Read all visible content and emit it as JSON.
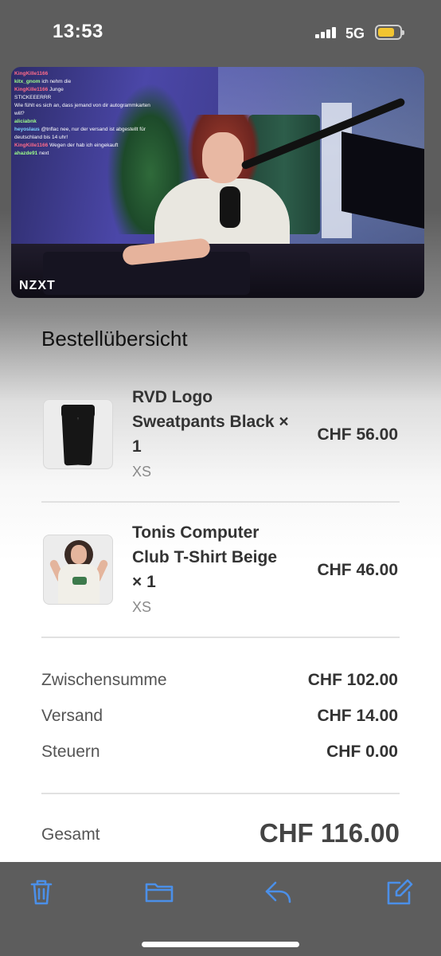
{
  "status_bar": {
    "time": "13:53",
    "network": "5G",
    "battery_color": "#f2c531"
  },
  "video": {
    "watermark": "NZXT",
    "chat": [
      {
        "user": "KingKille1166",
        "text": ""
      },
      {
        "user": "kitx_gnom",
        "text": "ich nehm die"
      },
      {
        "user": "KingKille1166",
        "text": "Junge"
      },
      {
        "user": "",
        "text": "STICKEEERRR"
      },
      {
        "user": "",
        "text": "Wie fühlt es sich an, dass jemand von dir autogrammkarten will?"
      },
      {
        "user": "aliciabnk",
        "text": ""
      },
      {
        "user": "heyoslaus",
        "text": "@tnflac nee, nur der versand ist abgestellt für deutschland bis 14 uhr!"
      },
      {
        "user": "KingKille1166",
        "text": "Wegen der hab ich eingekauft"
      },
      {
        "user": "ahazde91",
        "text": "next"
      }
    ]
  },
  "order": {
    "title": "Bestellübersicht",
    "items": [
      {
        "name": "RVD Logo Sweatpants Black × 1",
        "variant": "XS",
        "price": "CHF 56.00",
        "thumb_icon": "sweatpants-image"
      },
      {
        "name": "Tonis Computer Club T-Shirt Beige × 1",
        "variant": "XS",
        "price": "CHF 46.00",
        "thumb_icon": "tshirt-image"
      }
    ],
    "summary": [
      {
        "label": "Zwischensumme",
        "value": "CHF 102.00"
      },
      {
        "label": "Versand",
        "value": "CHF 14.00"
      },
      {
        "label": "Steuern",
        "value": "CHF 0.00"
      }
    ],
    "total_label": "Gesamt",
    "total_value": "CHF 116.00"
  },
  "toolbar": {
    "accent": "#4b8fe8",
    "buttons": [
      "trash-icon",
      "folder-icon",
      "reply-icon",
      "compose-icon"
    ]
  }
}
